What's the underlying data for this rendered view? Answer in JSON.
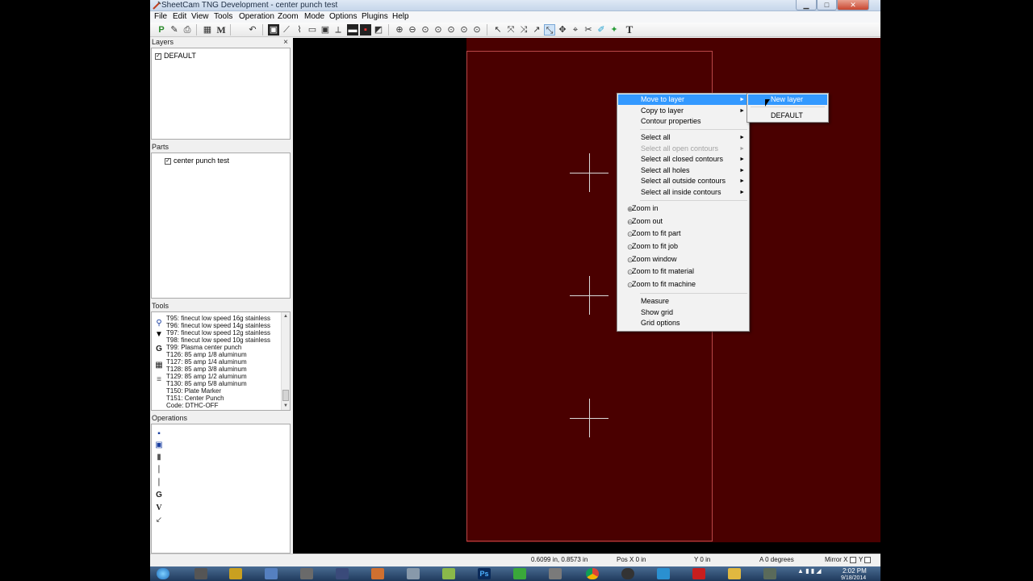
{
  "window": {
    "title": "SheetCam TNG Development - center punch test"
  },
  "menubar": {
    "items": [
      "File",
      "Edit",
      "View",
      "Tools",
      "Operation",
      "Zoom",
      "Mode",
      "Options",
      "Plugins",
      "Help"
    ]
  },
  "toolbar": {
    "p_label": "P",
    "m_label": "M",
    "t_label": "T"
  },
  "panels": {
    "layers": {
      "title": "Layers",
      "close": "×",
      "items": [
        "DEFAULT"
      ]
    },
    "parts": {
      "title": "Parts",
      "items": [
        "center punch test"
      ]
    },
    "tools": {
      "title": "Tools",
      "items": [
        "T95: finecut low speed 16g stainless",
        "T96: finecut low speed 14g stainless",
        "T97: finecut low speed 12g stainless",
        "T98: finecut low speed 10g stainless",
        "T99: Plasma center punch",
        "T126: 85 amp 1/8 aluminum",
        "T127: 85 amp 1/4 aluminum",
        "T128: 85 amp 3/8 aluminum",
        "T129: 85 amp 1/2 aluminum",
        "T130: 85 amp 5/8 aluminum",
        "T150: Plate Marker",
        "T151: Center Punch",
        "Code: DTHC-OFF"
      ]
    },
    "operations": {
      "title": "Operations"
    }
  },
  "context_menu": {
    "items": [
      {
        "label": "Move to layer",
        "submenu": true,
        "highlighted": true
      },
      {
        "label": "Copy to layer",
        "submenu": true
      },
      {
        "label": "Contour properties"
      },
      {
        "separator": true
      },
      {
        "label": "Select all",
        "submenu": true
      },
      {
        "label": "Select all open contours",
        "submenu": true,
        "disabled": true
      },
      {
        "label": "Select all closed contours",
        "submenu": true
      },
      {
        "label": "Select all holes",
        "submenu": true
      },
      {
        "label": "Select all outside contours",
        "submenu": true
      },
      {
        "label": "Select all inside contours",
        "submenu": true
      },
      {
        "separator": true
      },
      {
        "label": "Zoom in",
        "icon": "zoom-in-icon"
      },
      {
        "label": "Zoom out",
        "icon": "zoom-out-icon"
      },
      {
        "label": "Zoom to fit part",
        "icon": "zoom-fit-part-icon"
      },
      {
        "label": "Zoom to fit job",
        "icon": "zoom-fit-job-icon"
      },
      {
        "label": "Zoom window",
        "icon": "zoom-window-icon"
      },
      {
        "label": "Zoom to fit material",
        "icon": "zoom-fit-material-icon"
      },
      {
        "label": "Zoom to fit machine",
        "icon": "zoom-fit-machine-icon"
      },
      {
        "separator": true
      },
      {
        "label": "Measure"
      },
      {
        "label": "Show grid"
      },
      {
        "label": "Grid options"
      }
    ]
  },
  "submenu": {
    "items": [
      {
        "label": "New layer",
        "highlighted": true
      },
      {
        "label": "DEFAULT"
      }
    ]
  },
  "statusbar": {
    "coords": "0.6099 in, 0.8573 in",
    "pos_x": "Pos X  0 in",
    "y": "Y  0 in",
    "angle": "A  0 degrees",
    "mirror": "Mirror X",
    "mirror_y": "Y"
  },
  "taskbar": {
    "time": "2:02 PM",
    "date": "9/18/2014",
    "ps_label": "Ps"
  },
  "colors": {
    "sheet": "#4a0000",
    "part_outline": "#b94848",
    "highlight": "#3399ff",
    "canvas": "#000000"
  }
}
